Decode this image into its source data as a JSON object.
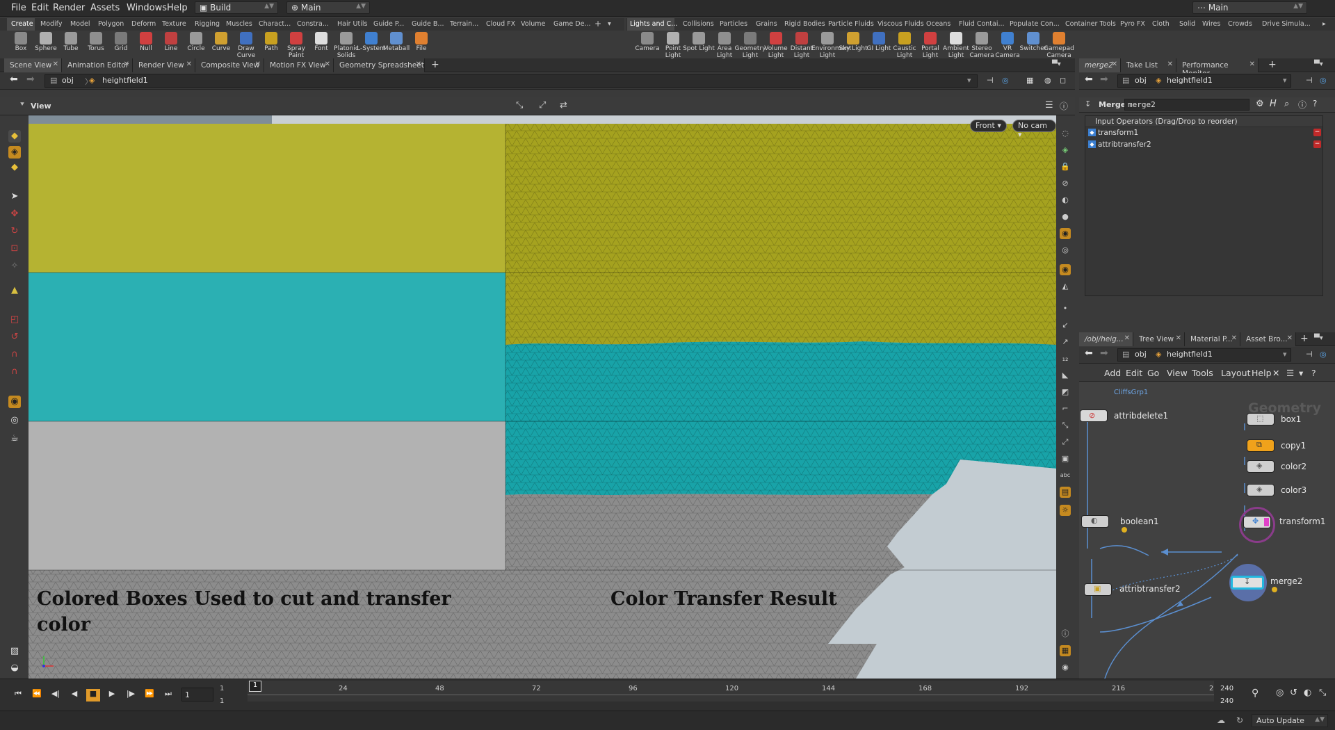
{
  "menubar": {
    "items": [
      "File",
      "Edit",
      "Render",
      "Assets",
      "Windows",
      "Help"
    ],
    "desktop": "Build",
    "context": "Main",
    "right_context": "Main"
  },
  "shelf_left": {
    "tabs": [
      "Create",
      "Modify",
      "Model",
      "Polygon",
      "Deform",
      "Texture",
      "Rigging",
      "Muscles",
      "Charact...",
      "Constra...",
      "Hair Utils",
      "Guide P...",
      "Guide B...",
      "Terrain...",
      "Cloud FX",
      "Volume",
      "Game De..."
    ],
    "tools": [
      "Box",
      "Sphere",
      "Tube",
      "Torus",
      "Grid",
      "Null",
      "Line",
      "Circle",
      "Curve",
      "Draw Curve",
      "Path",
      "Spray Paint",
      "Font",
      "Platonic Solids",
      "L-System",
      "Metaball",
      "File"
    ]
  },
  "shelf_right": {
    "tabs": [
      "Lights and C...",
      "Collisions",
      "Particles",
      "Grains",
      "Rigid Bodies",
      "Particle Fluids",
      "Viscous Fluids",
      "Oceans",
      "Fluid Contai...",
      "Populate Con...",
      "Container Tools",
      "Pyro FX",
      "Cloth",
      "Solid",
      "Wires",
      "Crowds",
      "Drive Simula..."
    ],
    "tools": [
      "Camera",
      "Point Light",
      "Spot Light",
      "Area Light",
      "Geometry Light",
      "Volume Light",
      "Distant Light",
      "Environment Light",
      "Sky Light",
      "GI Light",
      "Caustic Light",
      "Portal Light",
      "Ambient Light",
      "Stereo Camera",
      "VR Camera",
      "Switcher",
      "Gamepad Camera"
    ]
  },
  "main_tabs": [
    "Scene View",
    "Animation Editor",
    "Render View",
    "Composite View",
    "Motion FX View",
    "Geometry Spreadsheet"
  ],
  "path": {
    "root": "obj",
    "node": "heightfield1"
  },
  "viewport": {
    "label": "View",
    "view_button": "Front",
    "cam_button": "No cam",
    "caption_left": "Colored Boxes Used to cut and transfer color",
    "caption_right": "Color Transfer Result",
    "colors": {
      "yellow": "#b5b332",
      "teal": "#2bb0b3",
      "grey": "#b2b2b2",
      "mesh_grey": "#8c8c8c"
    }
  },
  "timeline": {
    "frame": "1",
    "start1": "1",
    "start2": "1",
    "current_marker": "1",
    "ticks": [
      "24",
      "48",
      "72",
      "96",
      "120",
      "144",
      "168",
      "192",
      "216",
      "2"
    ],
    "end1": "240",
    "end2": "240"
  },
  "status": {
    "auto_update": "Auto Update"
  },
  "param_pane": {
    "tabs": [
      "merge2",
      "Take List",
      "Performance Monitor"
    ],
    "node_type": "Merge",
    "node_name": "merge2",
    "list_header": "Input Operators (Drag/Drop to reorder)",
    "inputs": [
      "transform1",
      "attribtransfer2"
    ]
  },
  "network_pane": {
    "tabs": [
      "/obj/heig...",
      "Tree View",
      "Material P...",
      "Asset Bro..."
    ],
    "menu": [
      "Add",
      "Edit",
      "Go",
      "View",
      "Tools",
      "Layout",
      "Help"
    ],
    "context_label": "Geometry",
    "subnet_label": "CliffsGrp1",
    "nodes": [
      "attribdelete1",
      "box1",
      "copy1",
      "color2",
      "color3",
      "boolean1",
      "transform1",
      "attribtransfer2",
      "merge2"
    ]
  }
}
